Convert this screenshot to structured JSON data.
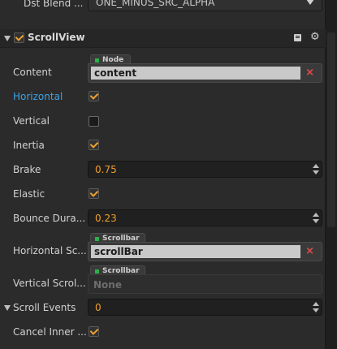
{
  "top": {
    "label": "Dst Blend ...",
    "value": "ONE_MINUS_SRC_ALPHA"
  },
  "section": {
    "title": "ScrollView",
    "enabled": true
  },
  "fields": {
    "content": {
      "label": "Content",
      "type_tag": "Node",
      "value": "content"
    },
    "horizontal": {
      "label": "Horizontal",
      "checked": true
    },
    "vertical": {
      "label": "Vertical",
      "checked": false
    },
    "inertia": {
      "label": "Inertia",
      "checked": true
    },
    "brake": {
      "label": "Brake",
      "value": "0.75"
    },
    "elastic": {
      "label": "Elastic",
      "checked": true
    },
    "bounce": {
      "label": "Bounce Dura...",
      "value": "0.23"
    },
    "hscroll": {
      "label": "Horizontal Sc...",
      "type_tag": "Scrollbar",
      "value": "scrollBar"
    },
    "vscroll": {
      "label": "Vertical Scrol...",
      "type_tag": "Scrollbar",
      "placeholder": "None"
    },
    "scroll_events": {
      "label": "Scroll Events",
      "value": "0"
    },
    "cancel_inner": {
      "label": "Cancel Inner ...",
      "checked": true
    }
  },
  "colors": {
    "accent": "#f09f2b",
    "active_label": "#3ea2e6",
    "clear": "#e24c4c"
  },
  "icons": {
    "clear": "×"
  }
}
